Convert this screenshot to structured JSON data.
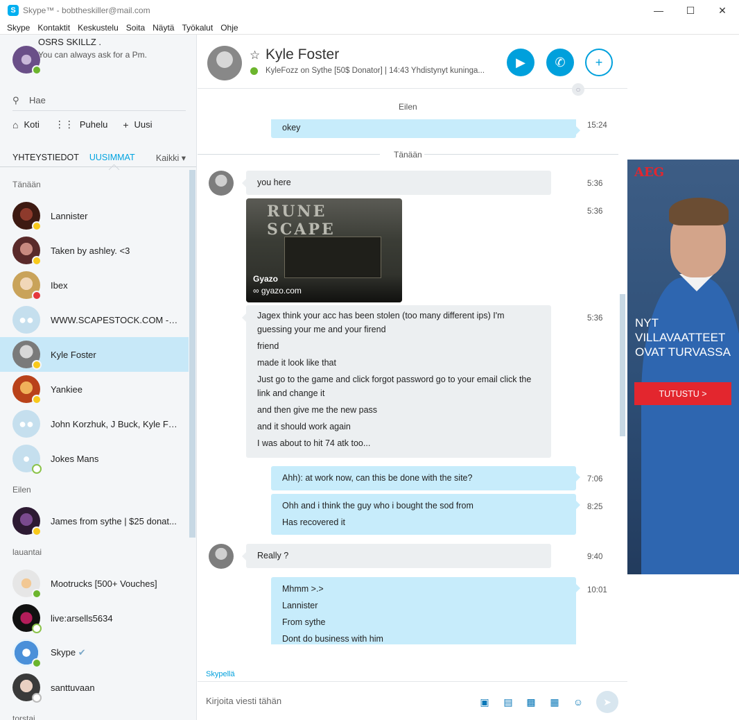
{
  "window": {
    "title": "Skype™ - bobtheskiller@mail.com",
    "minimize_label": "—",
    "maximize_label": "☐",
    "close_label": "✕"
  },
  "menu": [
    "Skype",
    "Kontaktit",
    "Keskustelu",
    "Soita",
    "Näytä",
    "Työkalut",
    "Ohje"
  ],
  "profile": {
    "name": "OSRS SKILLZ .",
    "mood": "You can always ask for a Pm."
  },
  "search": {
    "placeholder": "Hae"
  },
  "nav": {
    "home": "Koti",
    "call": "Puhelu",
    "new": "Uusi"
  },
  "tabs": {
    "contacts": "YHTEYSTIEDOT",
    "recent": "UUSIMMAT",
    "filter": "Kaikki"
  },
  "sections": {
    "today": "Tänään",
    "yesterday": "Eilen",
    "saturday": "lauantai",
    "thursday": "torstai"
  },
  "contacts": [
    {
      "name": "Lannister",
      "status": "away"
    },
    {
      "name": "Taken by ashley. <3",
      "status": "away"
    },
    {
      "name": "Ibex",
      "status": "busy"
    },
    {
      "name": "WWW.SCAPESTOCK.COM -RS...",
      "status": "group"
    },
    {
      "name": "Kyle Foster",
      "status": "away"
    },
    {
      "name": "Yankiee",
      "status": "away"
    },
    {
      "name": "John Korzhuk, J Buck, Kyle Fos...",
      "status": "group"
    },
    {
      "name": "Jokes Mans",
      "status": "offline"
    },
    {
      "name": "James from sythe | $25 donat...",
      "status": "away"
    },
    {
      "name": "Mootrucks [500+ Vouches]",
      "status": "online"
    },
    {
      "name": "live:arsells5634",
      "status": "offline"
    },
    {
      "name": "Skype",
      "status": "online"
    },
    {
      "name": "santtuvaan",
      "status": "unknown"
    }
  ],
  "chat": {
    "name": "Kyle Foster",
    "subtitle": "KyleFozz on Sythe [50$ Donator] | 14:43 Yhdistynyt kuninga...",
    "video_icon": "video-icon",
    "call_icon": "phone-icon",
    "add_icon": "add-person-icon"
  },
  "conversation": {
    "day_yesterday": "Eilen",
    "day_today": "Tänään",
    "messages": [
      {
        "dir": "out",
        "lines": [
          "okey"
        ],
        "time": "15:24"
      },
      {
        "dir": "in",
        "lines": [
          "you here"
        ],
        "time": "5:36"
      },
      {
        "dir": "in",
        "type": "image",
        "title": "Gyazo",
        "link": "gyazo.com",
        "logo": "RUNE SCAPE",
        "time": "5:36"
      },
      {
        "dir": "in",
        "lines": [
          "Jagex think your acc has been stolen (too many different ips) I'm guessing your me and your firend",
          "friend",
          "made it look like that",
          "Just go to the game and click forgot password go to your email click the link and change it",
          "and then give me the new pass",
          "and it should work again",
          "I was about to hit 74 atk too..."
        ],
        "time": "5:36"
      },
      {
        "dir": "out",
        "lines": [
          "Ahh): at work now, can this be done with the site?"
        ],
        "time": "7:06"
      },
      {
        "dir": "out",
        "lines": [
          "Ohh and i think the guy who i bought the sod from",
          "Has recovered it"
        ],
        "time": "8:25"
      },
      {
        "dir": "in",
        "lines": [
          "Really ?"
        ],
        "time": "9:40"
      },
      {
        "dir": "out",
        "lines": [
          "Mhmm >.>",
          "Lannister",
          "From sythe",
          "Dont do business with him"
        ],
        "time": "10:01"
      }
    ]
  },
  "footer": {
    "skypella": "Skypellä",
    "placeholder": "Kirjoita viesti tähän"
  },
  "ad": {
    "brand": "AEG",
    "headline_1": "NYT",
    "headline_2": "VILLAVAATTEET",
    "headline_3": "OVAT TURVASSA",
    "cta": "TUTUSTU >"
  }
}
